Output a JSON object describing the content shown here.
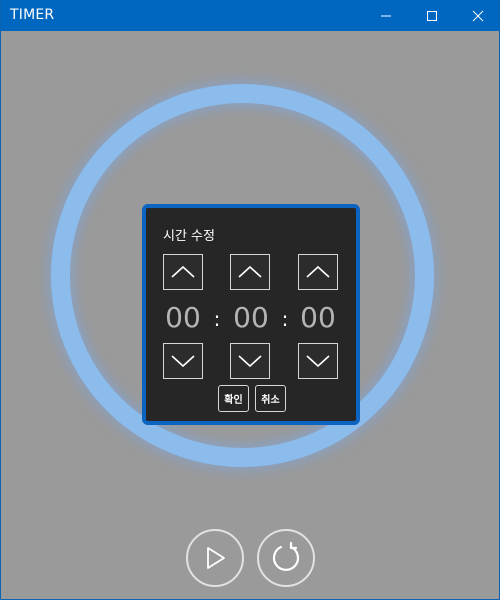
{
  "window": {
    "title": "TIMER",
    "controls": [
      "minimize-icon",
      "maximize-icon",
      "close-icon"
    ]
  },
  "colors": {
    "titlebar": "#0067c0",
    "background": "#9a9a9a",
    "ring": "#8cbcec",
    "dialog_bg": "#262626",
    "dialog_border": "#0a64c0",
    "digits": "#b4b4b4"
  },
  "dialog": {
    "title": "시간 수정",
    "hours": "00",
    "minutes": "00",
    "seconds": "00",
    "separator": ":",
    "up_icon": "chevron-up-icon",
    "down_icon": "chevron-down-icon",
    "confirm_label": "확인",
    "cancel_label": "취소"
  },
  "controls": {
    "play_icon": "play-icon",
    "reset_icon": "reset-icon"
  }
}
